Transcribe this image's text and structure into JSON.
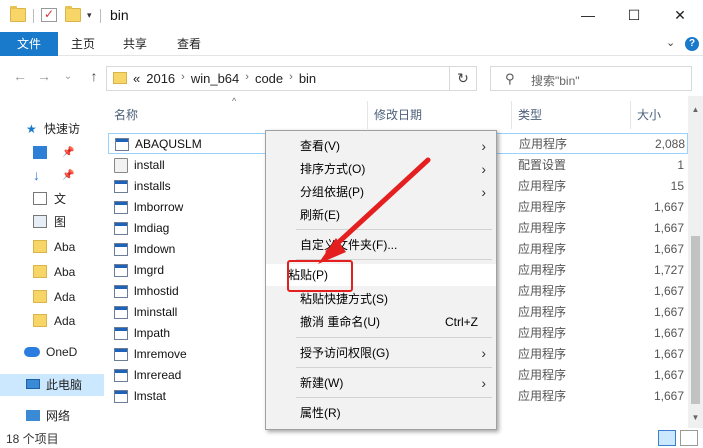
{
  "window": {
    "title": "bin",
    "minimize": "—",
    "maximize": "☐",
    "close": "✕"
  },
  "ribbon": {
    "tabs": [
      "文件",
      "主页",
      "共享",
      "查看"
    ],
    "collapse": "⌄",
    "help": "?"
  },
  "nav": {
    "back": "←",
    "forward": "→",
    "recent": "⌄",
    "up": "↑",
    "breadcrumb_prefix": "«",
    "breadcrumbs": [
      "2016",
      "win_b64",
      "code",
      "bin"
    ],
    "dropdown": "⌄",
    "refresh": "↻",
    "search_placeholder": "搜索\"bin\""
  },
  "navpane": {
    "items": [
      {
        "label": "快速访",
        "icon": "star-icon"
      },
      {
        "label": "",
        "icon": "desktop-icon"
      },
      {
        "label": "",
        "icon": "download-icon"
      },
      {
        "label": "文",
        "icon": "document-icon"
      },
      {
        "label": "图",
        "icon": "picture-icon"
      },
      {
        "label": "Aba",
        "icon": "folder-icon"
      },
      {
        "label": "Aba",
        "icon": "folder-icon"
      },
      {
        "label": "Ada",
        "icon": "folder-icon"
      },
      {
        "label": "Ada",
        "icon": "folder-icon"
      },
      {
        "label": "OneD",
        "icon": "onedrive-icon"
      },
      {
        "label": "此电脑",
        "icon": "pc-icon"
      },
      {
        "label": "网络",
        "icon": "network-icon"
      }
    ]
  },
  "columns": {
    "name": "名称",
    "modified": "修改日期",
    "type": "类型",
    "size": "大小"
  },
  "files": [
    {
      "name": "ABAQUSLM",
      "type": "应用程序",
      "size": "2,088",
      "icon": "exe-icon"
    },
    {
      "name": "install",
      "type": "配置设置",
      "size": "1",
      "icon": "config-icon"
    },
    {
      "name": "installs",
      "type": "应用程序",
      "size": "15",
      "icon": "exe-icon"
    },
    {
      "name": "lmborrow",
      "type": "应用程序",
      "size": "1,667",
      "icon": "exe-icon"
    },
    {
      "name": "lmdiag",
      "type": "应用程序",
      "size": "1,667",
      "icon": "exe-icon"
    },
    {
      "name": "lmdown",
      "type": "应用程序",
      "size": "1,667",
      "icon": "exe-icon"
    },
    {
      "name": "lmgrd",
      "type": "应用程序",
      "size": "1,727",
      "icon": "exe-icon"
    },
    {
      "name": "lmhostid",
      "type": "应用程序",
      "size": "1,667",
      "icon": "exe-icon"
    },
    {
      "name": "lminstall",
      "type": "应用程序",
      "size": "1,667",
      "icon": "exe-icon"
    },
    {
      "name": "lmpath",
      "type": "应用程序",
      "size": "1,667",
      "icon": "exe-icon"
    },
    {
      "name": "lmremove",
      "type": "应用程序",
      "size": "1,667",
      "icon": "exe-icon"
    },
    {
      "name": "lmreread",
      "type": "应用程序",
      "size": "1,667",
      "icon": "exe-icon"
    },
    {
      "name": "lmstat",
      "type": "应用程序",
      "size": "1,667",
      "icon": "exe-icon"
    }
  ],
  "status": {
    "count": "18 个项目"
  },
  "context_menu": {
    "view": "查看(V)",
    "sort": "排序方式(O)",
    "group": "分组依据(P)",
    "refresh": "刷新(E)",
    "customize": "自定义文件夹(F)...",
    "paste": "粘贴(P)",
    "paste_shortcut": "粘贴快捷方式(S)",
    "undo": "撤消 重命名(U)",
    "undo_shortcut": "Ctrl+Z",
    "grant_access": "授予访问权限(G)",
    "new": "新建(W)",
    "properties": "属性(R)"
  },
  "colors": {
    "accent": "#1979ca",
    "selection": "#cce8ff",
    "annotation": "#e41f1f"
  }
}
